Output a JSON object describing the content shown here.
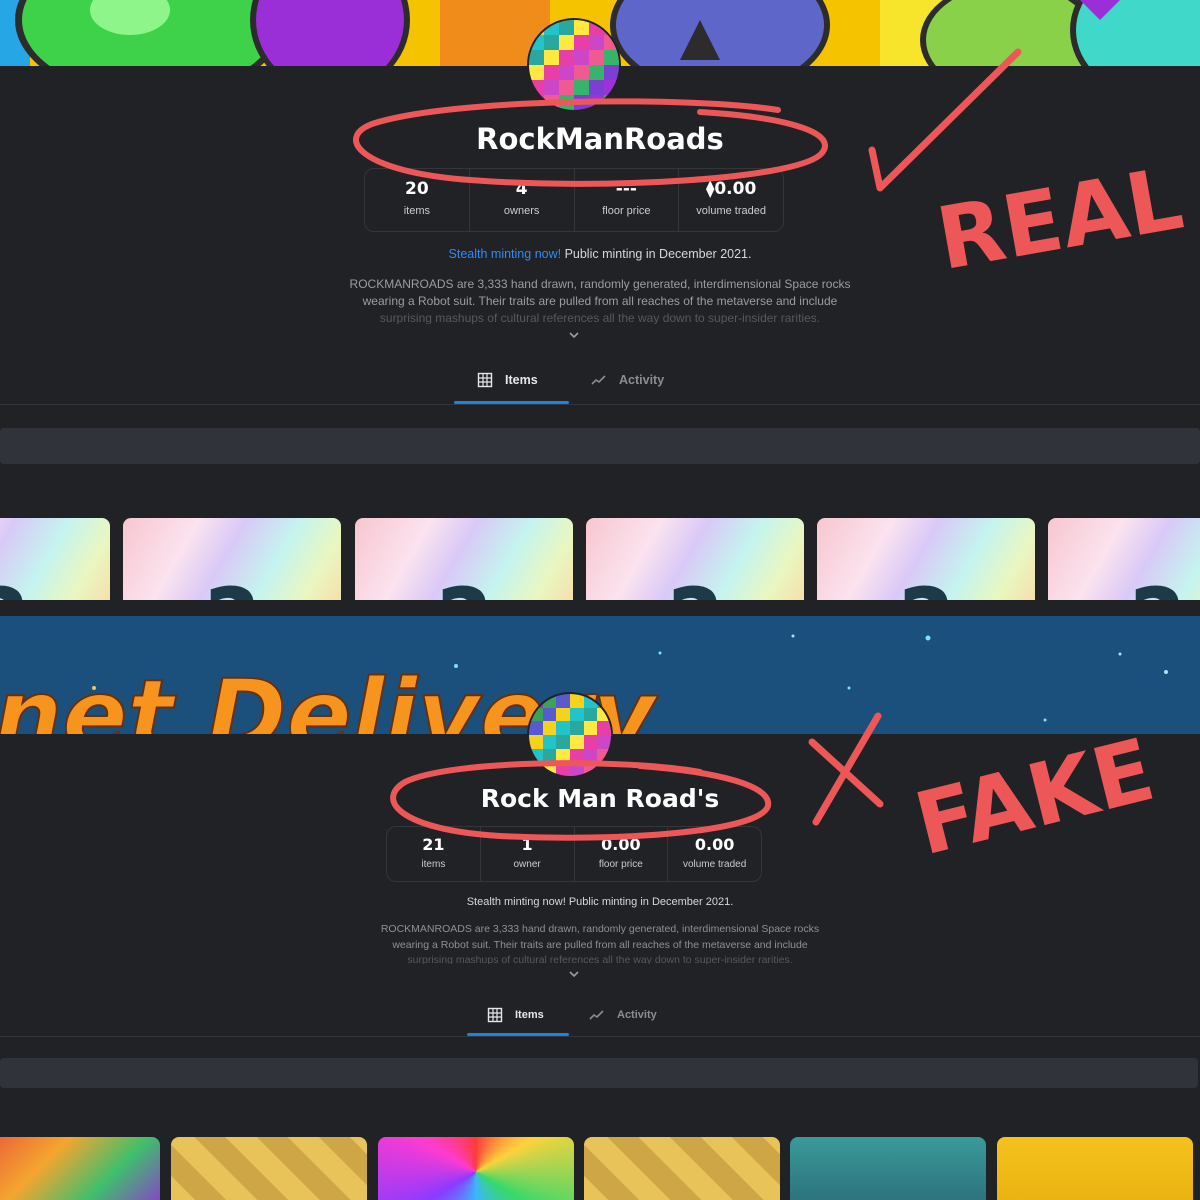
{
  "real": {
    "collection_name": "RockManRoads",
    "stats": [
      {
        "value": "20",
        "label": "items"
      },
      {
        "value": "4",
        "label": "owners"
      },
      {
        "value": "---",
        "label": "floor price"
      },
      {
        "value": "⧫0.00",
        "label": "volume traded"
      }
    ],
    "minting_highlight": "Stealth minting now!",
    "minting_rest": " Public minting in December 2021.",
    "description_1": "ROCKMANROADS are 3,333 hand drawn, randomly generated, interdimensional Space rocks",
    "description_2": "wearing a Robot suit. Their traits are pulled from all reaches of the metaverse and include",
    "description_3": "surprising mashups of cultural references all the way down to super-insider rarities.",
    "tabs": {
      "items": "Items",
      "activity": "Activity"
    },
    "card_placeholder": "?",
    "annotation": "REAL",
    "check_mark": "✓"
  },
  "fake": {
    "collection_name": "Rock Man Road's",
    "banner_text": "net Delivery",
    "stats": [
      {
        "value": "21",
        "label": "items"
      },
      {
        "value": "1",
        "label": "owner"
      },
      {
        "value": "0.00",
        "label": "floor price"
      },
      {
        "value": "0.00",
        "label": "volume traded"
      }
    ],
    "minting": "Stealth minting now! Public minting in December 2021.",
    "description_1": "ROCKMANROADS are 3,333 hand drawn, randomly generated, interdimensional Space rocks",
    "description_2": "wearing a Robot suit. Their traits are pulled from all reaches of the metaverse and include",
    "description_3": "surprising mashups of cultural references all the way down to super-insider rarities.",
    "tabs": {
      "items": "Items",
      "activity": "Activity"
    },
    "annotation": "FAKE",
    "cross_mark": "X"
  },
  "colors": {
    "background": "#202225",
    "accent_blue": "#2081e2",
    "marker_red": "#ee5757",
    "fake_banner": "#1b507c"
  },
  "icons": {
    "items_tab": "grid-icon",
    "activity_tab": "trending-line-icon",
    "expand": "chevron-down-icon",
    "currency": "ethereum-icon"
  }
}
